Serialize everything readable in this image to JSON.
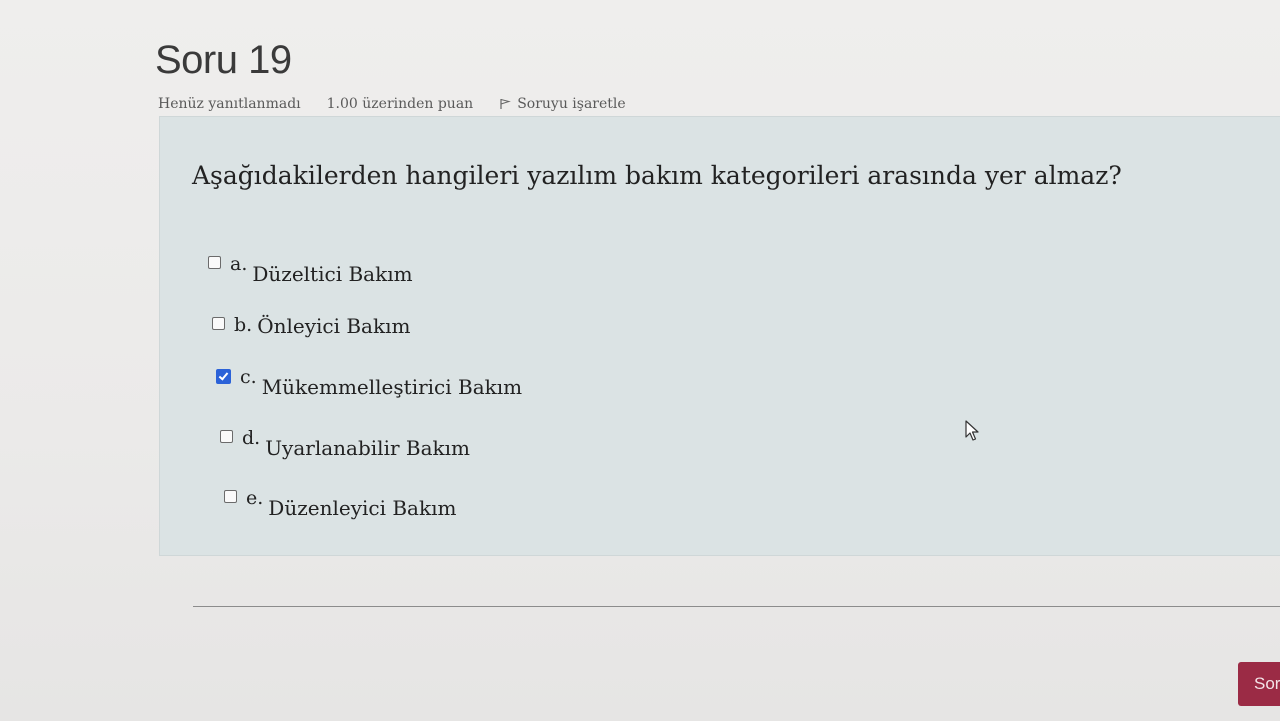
{
  "question": {
    "title": "Soru 19",
    "status": "Henüz yanıtlanmadı",
    "points": "1.00 üzerinden puan",
    "flag_label": "Soruyu işaretle",
    "text": "Aşağıdakilerden hangileri yazılım bakım kategorileri arasında yer almaz?"
  },
  "options": [
    {
      "letter": "a.",
      "text": "Düzeltici Bakım",
      "checked": false
    },
    {
      "letter": "b.",
      "text": "Önleyici Bakım",
      "checked": false
    },
    {
      "letter": "c.",
      "text": "Mükemmelleştirici Bakım",
      "checked": true
    },
    {
      "letter": "d.",
      "text": "Uyarlanabilir Bakım",
      "checked": false
    },
    {
      "letter": "e.",
      "text": "Düzenleyici Bakım",
      "checked": false
    }
  ],
  "navigation": {
    "next_label": "Sor"
  },
  "colors": {
    "accent": "#2b62d8",
    "button": "#9b2b45",
    "question_box": "#dbe3e4"
  },
  "icons": {
    "flag": "flag-icon",
    "checkbox": "checkbox-icon",
    "cursor": "mouse-cursor-icon"
  }
}
